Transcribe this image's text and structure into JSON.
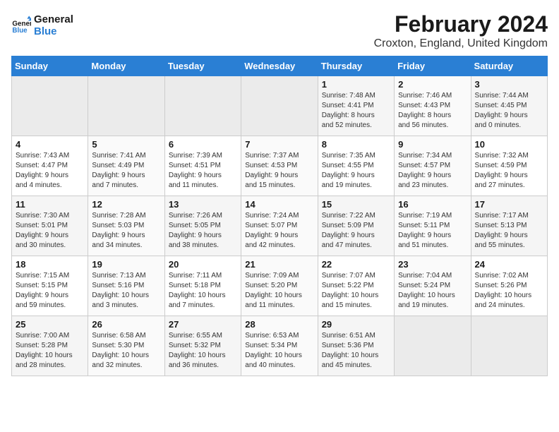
{
  "header": {
    "logo_line1": "General",
    "logo_line2": "Blue",
    "month": "February 2024",
    "location": "Croxton, England, United Kingdom"
  },
  "days_of_week": [
    "Sunday",
    "Monday",
    "Tuesday",
    "Wednesday",
    "Thursday",
    "Friday",
    "Saturday"
  ],
  "weeks": [
    [
      {
        "day": "",
        "info": ""
      },
      {
        "day": "",
        "info": ""
      },
      {
        "day": "",
        "info": ""
      },
      {
        "day": "",
        "info": ""
      },
      {
        "day": "1",
        "info": "Sunrise: 7:48 AM\nSunset: 4:41 PM\nDaylight: 8 hours\nand 52 minutes."
      },
      {
        "day": "2",
        "info": "Sunrise: 7:46 AM\nSunset: 4:43 PM\nDaylight: 8 hours\nand 56 minutes."
      },
      {
        "day": "3",
        "info": "Sunrise: 7:44 AM\nSunset: 4:45 PM\nDaylight: 9 hours\nand 0 minutes."
      }
    ],
    [
      {
        "day": "4",
        "info": "Sunrise: 7:43 AM\nSunset: 4:47 PM\nDaylight: 9 hours\nand 4 minutes."
      },
      {
        "day": "5",
        "info": "Sunrise: 7:41 AM\nSunset: 4:49 PM\nDaylight: 9 hours\nand 7 minutes."
      },
      {
        "day": "6",
        "info": "Sunrise: 7:39 AM\nSunset: 4:51 PM\nDaylight: 9 hours\nand 11 minutes."
      },
      {
        "day": "7",
        "info": "Sunrise: 7:37 AM\nSunset: 4:53 PM\nDaylight: 9 hours\nand 15 minutes."
      },
      {
        "day": "8",
        "info": "Sunrise: 7:35 AM\nSunset: 4:55 PM\nDaylight: 9 hours\nand 19 minutes."
      },
      {
        "day": "9",
        "info": "Sunrise: 7:34 AM\nSunset: 4:57 PM\nDaylight: 9 hours\nand 23 minutes."
      },
      {
        "day": "10",
        "info": "Sunrise: 7:32 AM\nSunset: 4:59 PM\nDaylight: 9 hours\nand 27 minutes."
      }
    ],
    [
      {
        "day": "11",
        "info": "Sunrise: 7:30 AM\nSunset: 5:01 PM\nDaylight: 9 hours\nand 30 minutes."
      },
      {
        "day": "12",
        "info": "Sunrise: 7:28 AM\nSunset: 5:03 PM\nDaylight: 9 hours\nand 34 minutes."
      },
      {
        "day": "13",
        "info": "Sunrise: 7:26 AM\nSunset: 5:05 PM\nDaylight: 9 hours\nand 38 minutes."
      },
      {
        "day": "14",
        "info": "Sunrise: 7:24 AM\nSunset: 5:07 PM\nDaylight: 9 hours\nand 42 minutes."
      },
      {
        "day": "15",
        "info": "Sunrise: 7:22 AM\nSunset: 5:09 PM\nDaylight: 9 hours\nand 47 minutes."
      },
      {
        "day": "16",
        "info": "Sunrise: 7:19 AM\nSunset: 5:11 PM\nDaylight: 9 hours\nand 51 minutes."
      },
      {
        "day": "17",
        "info": "Sunrise: 7:17 AM\nSunset: 5:13 PM\nDaylight: 9 hours\nand 55 minutes."
      }
    ],
    [
      {
        "day": "18",
        "info": "Sunrise: 7:15 AM\nSunset: 5:15 PM\nDaylight: 9 hours\nand 59 minutes."
      },
      {
        "day": "19",
        "info": "Sunrise: 7:13 AM\nSunset: 5:16 PM\nDaylight: 10 hours\nand 3 minutes."
      },
      {
        "day": "20",
        "info": "Sunrise: 7:11 AM\nSunset: 5:18 PM\nDaylight: 10 hours\nand 7 minutes."
      },
      {
        "day": "21",
        "info": "Sunrise: 7:09 AM\nSunset: 5:20 PM\nDaylight: 10 hours\nand 11 minutes."
      },
      {
        "day": "22",
        "info": "Sunrise: 7:07 AM\nSunset: 5:22 PM\nDaylight: 10 hours\nand 15 minutes."
      },
      {
        "day": "23",
        "info": "Sunrise: 7:04 AM\nSunset: 5:24 PM\nDaylight: 10 hours\nand 19 minutes."
      },
      {
        "day": "24",
        "info": "Sunrise: 7:02 AM\nSunset: 5:26 PM\nDaylight: 10 hours\nand 24 minutes."
      }
    ],
    [
      {
        "day": "25",
        "info": "Sunrise: 7:00 AM\nSunset: 5:28 PM\nDaylight: 10 hours\nand 28 minutes."
      },
      {
        "day": "26",
        "info": "Sunrise: 6:58 AM\nSunset: 5:30 PM\nDaylight: 10 hours\nand 32 minutes."
      },
      {
        "day": "27",
        "info": "Sunrise: 6:55 AM\nSunset: 5:32 PM\nDaylight: 10 hours\nand 36 minutes."
      },
      {
        "day": "28",
        "info": "Sunrise: 6:53 AM\nSunset: 5:34 PM\nDaylight: 10 hours\nand 40 minutes."
      },
      {
        "day": "29",
        "info": "Sunrise: 6:51 AM\nSunset: 5:36 PM\nDaylight: 10 hours\nand 45 minutes."
      },
      {
        "day": "",
        "info": ""
      },
      {
        "day": "",
        "info": ""
      }
    ]
  ]
}
